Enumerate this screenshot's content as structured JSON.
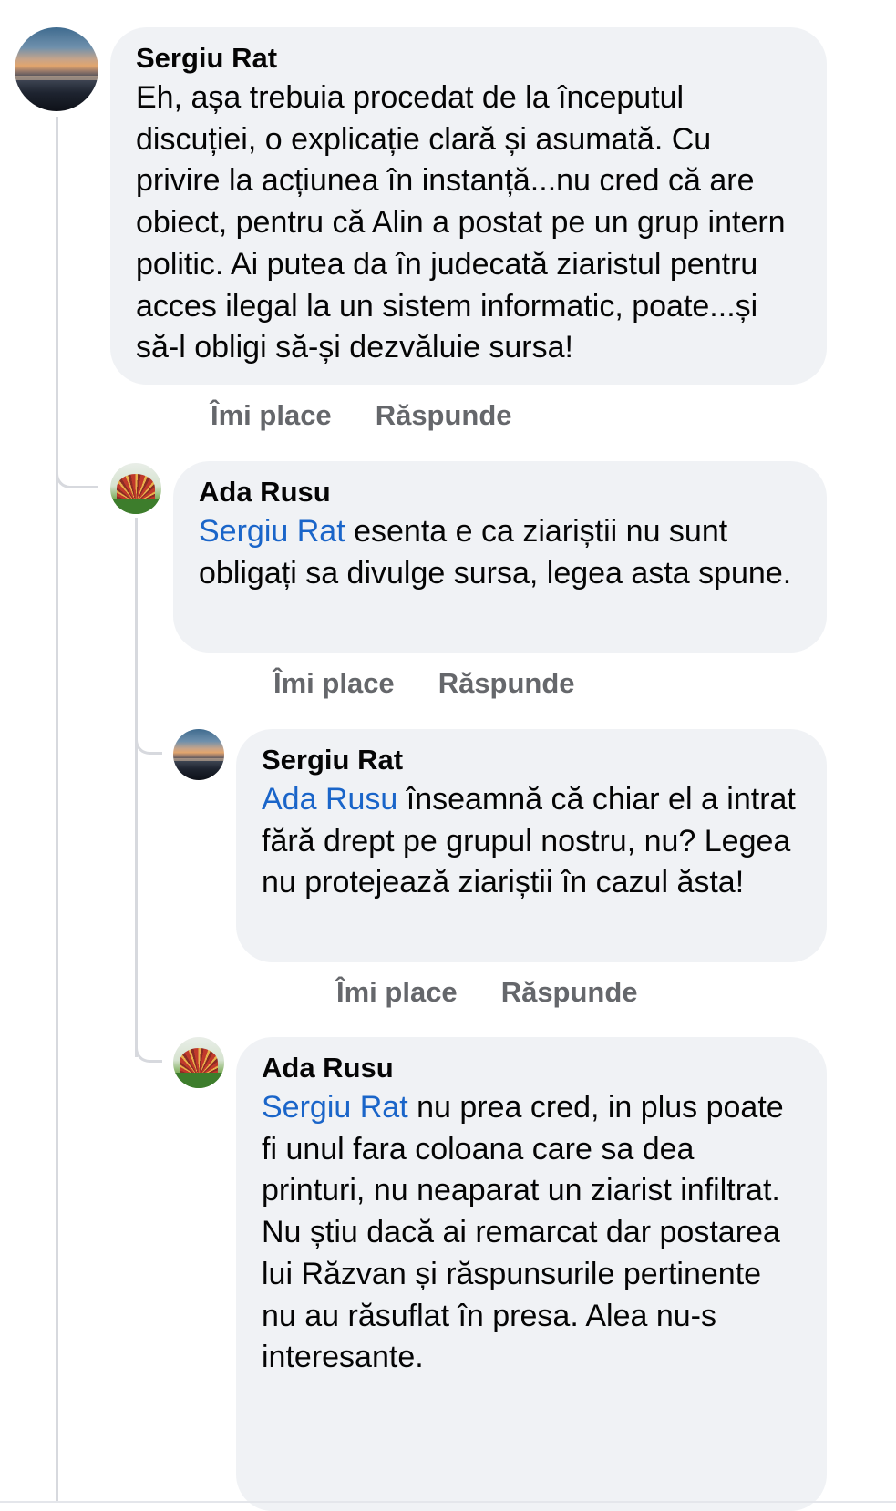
{
  "comments": [
    {
      "author": "Sergiu Rat",
      "mention": "",
      "text": "Eh, așa trebuia procedat de la începutul discuției, o explicație clară și asumată. Cu privire la acțiunea în instanță...nu cred că are obiect, pentru că Alin a postat pe un grup intern politic. Ai putea da în judecată ziaristul pentru acces ilegal la un sistem informatic, poate...și să-l obligi să-și dezvăluie sursa!",
      "like_label": "Îmi place",
      "reply_label": "Răspunde"
    },
    {
      "author": "Ada Rusu",
      "mention": "Sergiu Rat",
      "text": " esenta e ca ziariștii nu sunt obligați sa divulge sursa, legea asta spune.",
      "like_label": "Îmi place",
      "reply_label": "Răspunde"
    },
    {
      "author": "Sergiu Rat",
      "mention": "Ada Rusu",
      "text": " înseamnă că chiar el a intrat fără drept pe grupul nostru, nu? Legea nu protejează ziariștii în cazul ăsta!",
      "like_label": "Îmi place",
      "reply_label": "Răspunde"
    },
    {
      "author": "Ada Rusu",
      "mention": "Sergiu Rat",
      "text": " nu prea cred, in plus poate fi unul fara coloana care sa dea printuri, nu neaparat un ziarist infiltrat. Nu știu dacă ai remarcat dar postarea lui Răzvan și răspunsurile pertinente nu au răsuflat în presa. Alea nu-s interesante."
    }
  ]
}
